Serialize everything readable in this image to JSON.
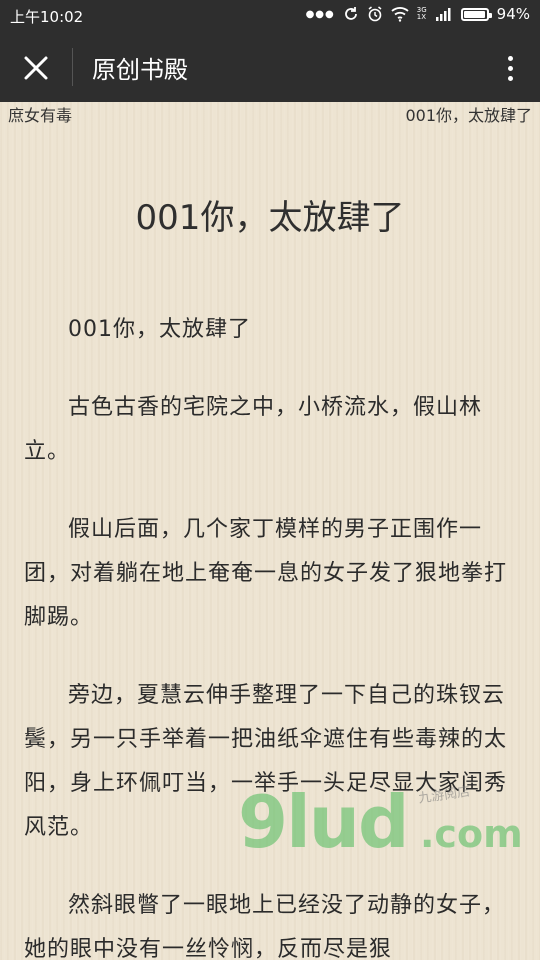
{
  "status_bar": {
    "time": "上午10:02",
    "battery": "94%",
    "battery_level": 0.94,
    "network_top": "3G",
    "network_bottom": "1X",
    "icons": [
      "dots-icon",
      "sync-icon",
      "alarm-icon",
      "wifi-icon",
      "signal-icon",
      "battery-icon"
    ]
  },
  "title_bar": {
    "title": "原创书殿",
    "close_icon": "close-icon",
    "more_icon": "more-vertical-icon"
  },
  "reader": {
    "book_name": "庶女有毒",
    "chapter_header": "001你，太放肆了",
    "chapter_title": "001你，太放肆了",
    "paragraphs": [
      "001你，太放肆了",
      "古色古香的宅院之中，小桥流水，假山林立。",
      "假山后面，几个家丁模样的男子正围作一团，对着躺在地上奄奄一息的女子发了狠地拳打脚踢。",
      "旁边，夏慧云伸手整理了一下自己的珠钗云鬓，另一只手举着一把油纸伞遮住有些毒辣的太阳，身上环佩叮当，一举手一头足尽显大家闺秀风范。",
      "然斜眼瞥了一眼地上已经没了动静的女子，她的眼中没有一丝怜悯，反而尽是狠"
    ]
  },
  "watermark": {
    "brand": "9lud",
    "domain": ".com",
    "small_text": "九游阅店"
  },
  "colors": {
    "bar": "#2e2e2e",
    "paper": "#ede4d2",
    "text": "#2b2b2b",
    "watermark": "#4cb95a"
  }
}
